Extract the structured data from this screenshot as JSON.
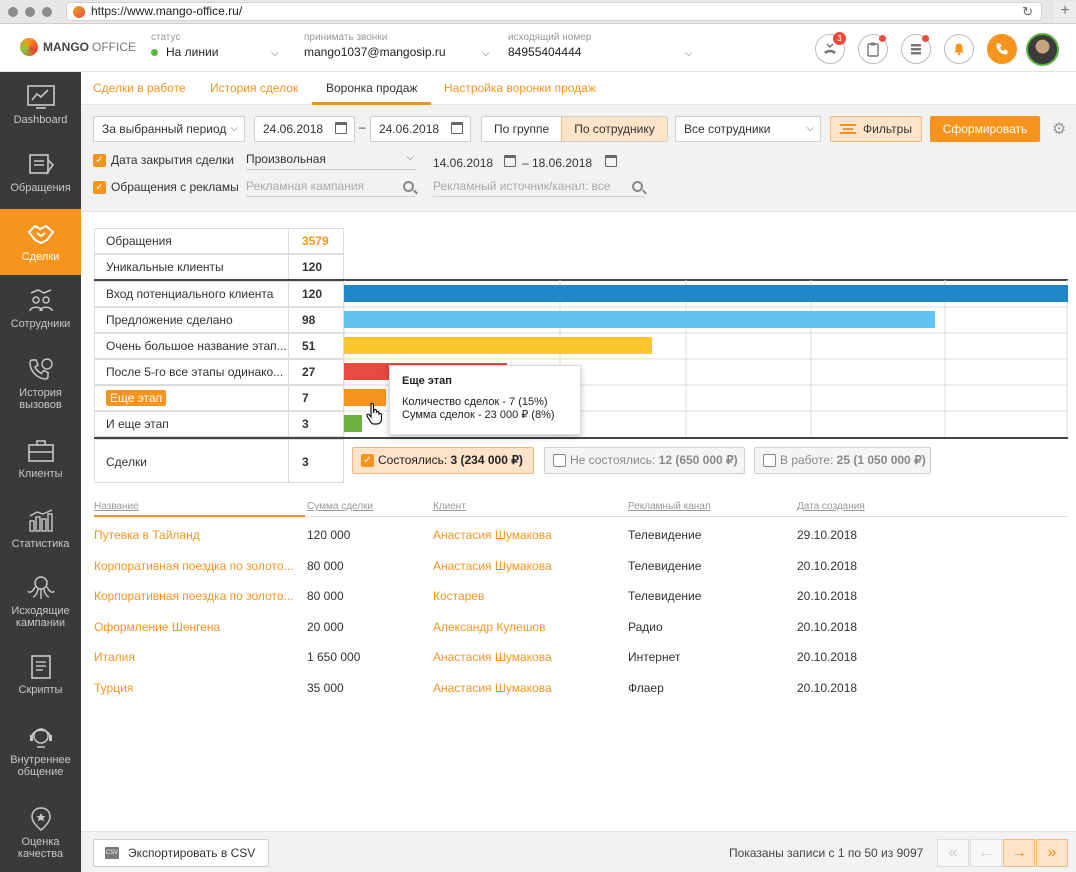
{
  "browser": {
    "url": "https://www.mango-office.ru/"
  },
  "header": {
    "logo_brand": "MANGO",
    "logo_sub": "OFFICE",
    "status_label": "статус",
    "status_value": "На линии",
    "accept_label": "принимать звонки",
    "accept_value": "mango1037@mangosip.ru",
    "outgoing_label": "исходящий номер",
    "outgoing_value": "84955404444",
    "missed_badge": "3"
  },
  "sidebar": {
    "items": [
      {
        "label": "Dashboard"
      },
      {
        "label": "Обращения"
      },
      {
        "label": "Сделки"
      },
      {
        "label": "Сотрудники"
      },
      {
        "label": "История вызовов"
      },
      {
        "label": "Клиенты"
      },
      {
        "label": "Статистика"
      },
      {
        "label": "Исходящие кампании"
      },
      {
        "label": "Скрипты"
      },
      {
        "label": "Внутреннее общение"
      },
      {
        "label": "Оценка качества"
      }
    ]
  },
  "tabs": [
    {
      "label": "Сделки в работе"
    },
    {
      "label": "История сделок"
    },
    {
      "label": "Воронка продаж"
    },
    {
      "label": "Настройка воронки продаж"
    }
  ],
  "filters": {
    "period": "За выбранный период",
    "date_from": "24.06.2018",
    "date_to": "24.06.2018",
    "dash": "–",
    "group_by_group": "По группе",
    "group_by_employee": "По сотруднику",
    "employees": "Все сотрудники",
    "filters_btn": "Фильтры",
    "submit_btn": "Сформировать",
    "close_date_label": "Дата закрытия сделки",
    "close_date_value": "Произвольная",
    "close_from": "14.06.2018",
    "close_to": "18.06.2018",
    "ads_label": "Обращения с рекламы",
    "campaign_placeholder": "Рекламная кампания",
    "source_placeholder": "Рекламный источник/канал: все"
  },
  "summary": [
    {
      "label": "Обращения",
      "value": "3579"
    },
    {
      "label": "Уникальные клиенты",
      "value": "120"
    }
  ],
  "chart_data": {
    "type": "bar",
    "categories": [
      "Вход потенциального клиента",
      "Предложение сделано",
      "Очень большое название этап...",
      "После 5-го все этапы одинако...",
      "Еще этап",
      "И еще этап"
    ],
    "values": [
      120,
      98,
      51,
      27,
      7,
      3
    ],
    "colors": [
      "#1f86c8",
      "#61c3f2",
      "#fcc72c",
      "#e54b3e",
      "#f7941d",
      "#6db33f"
    ],
    "xlim": [
      0,
      120
    ]
  },
  "funnel_values": [
    "120",
    "98",
    "51",
    "27",
    "7",
    "3"
  ],
  "deals_row": {
    "label": "Сделки",
    "value": "3"
  },
  "tooltip": {
    "title": "Еще этап",
    "line1": "Количество сделок - 7 (15%)",
    "line2": "Сумма сделок - 23 000 ₽  (8%)"
  },
  "legend": [
    {
      "prefix": "Состоялись: ",
      "value": "3 (234 000 ₽)"
    },
    {
      "prefix": "Не состоялись: ",
      "value": "12 (650 000 ₽)"
    },
    {
      "prefix": "В работе: ",
      "value": "25 (1 050 000 ₽)"
    }
  ],
  "table": {
    "headers": [
      "Название",
      "Сумма сделки",
      "Клиент",
      "Рекламный канал",
      "Дата создания"
    ],
    "rows": [
      [
        "Путевка в Тайланд",
        "120 000",
        "Анастасия Шумакова",
        "Телевидение",
        "29.10.2018"
      ],
      [
        "Корпоративная поездка по золото...",
        "80 000",
        "Анастасия Шумакова",
        "Телевидение",
        "20.10.2018"
      ],
      [
        "Корпоративная поездка по золото...",
        "80 000",
        "Костарев",
        "Телевидение",
        "20.10.2018"
      ],
      [
        "Оформление Шенгена",
        "20 000",
        "Александр Кулешов",
        "Радио",
        "20.10.2018"
      ],
      [
        "Италия",
        "1 650 000",
        "Анастасия Шумакова",
        "Интернет",
        "20.10.2018"
      ],
      [
        "Турция",
        "35 000",
        "Анастасия Шумакова",
        "Флаер",
        "20.10.2018"
      ]
    ]
  },
  "footer": {
    "csv_icon": "CSV",
    "export_btn": "Экспортировать в CSV",
    "pager_text": "Показаны записи с 1 по 50 из 9097"
  }
}
